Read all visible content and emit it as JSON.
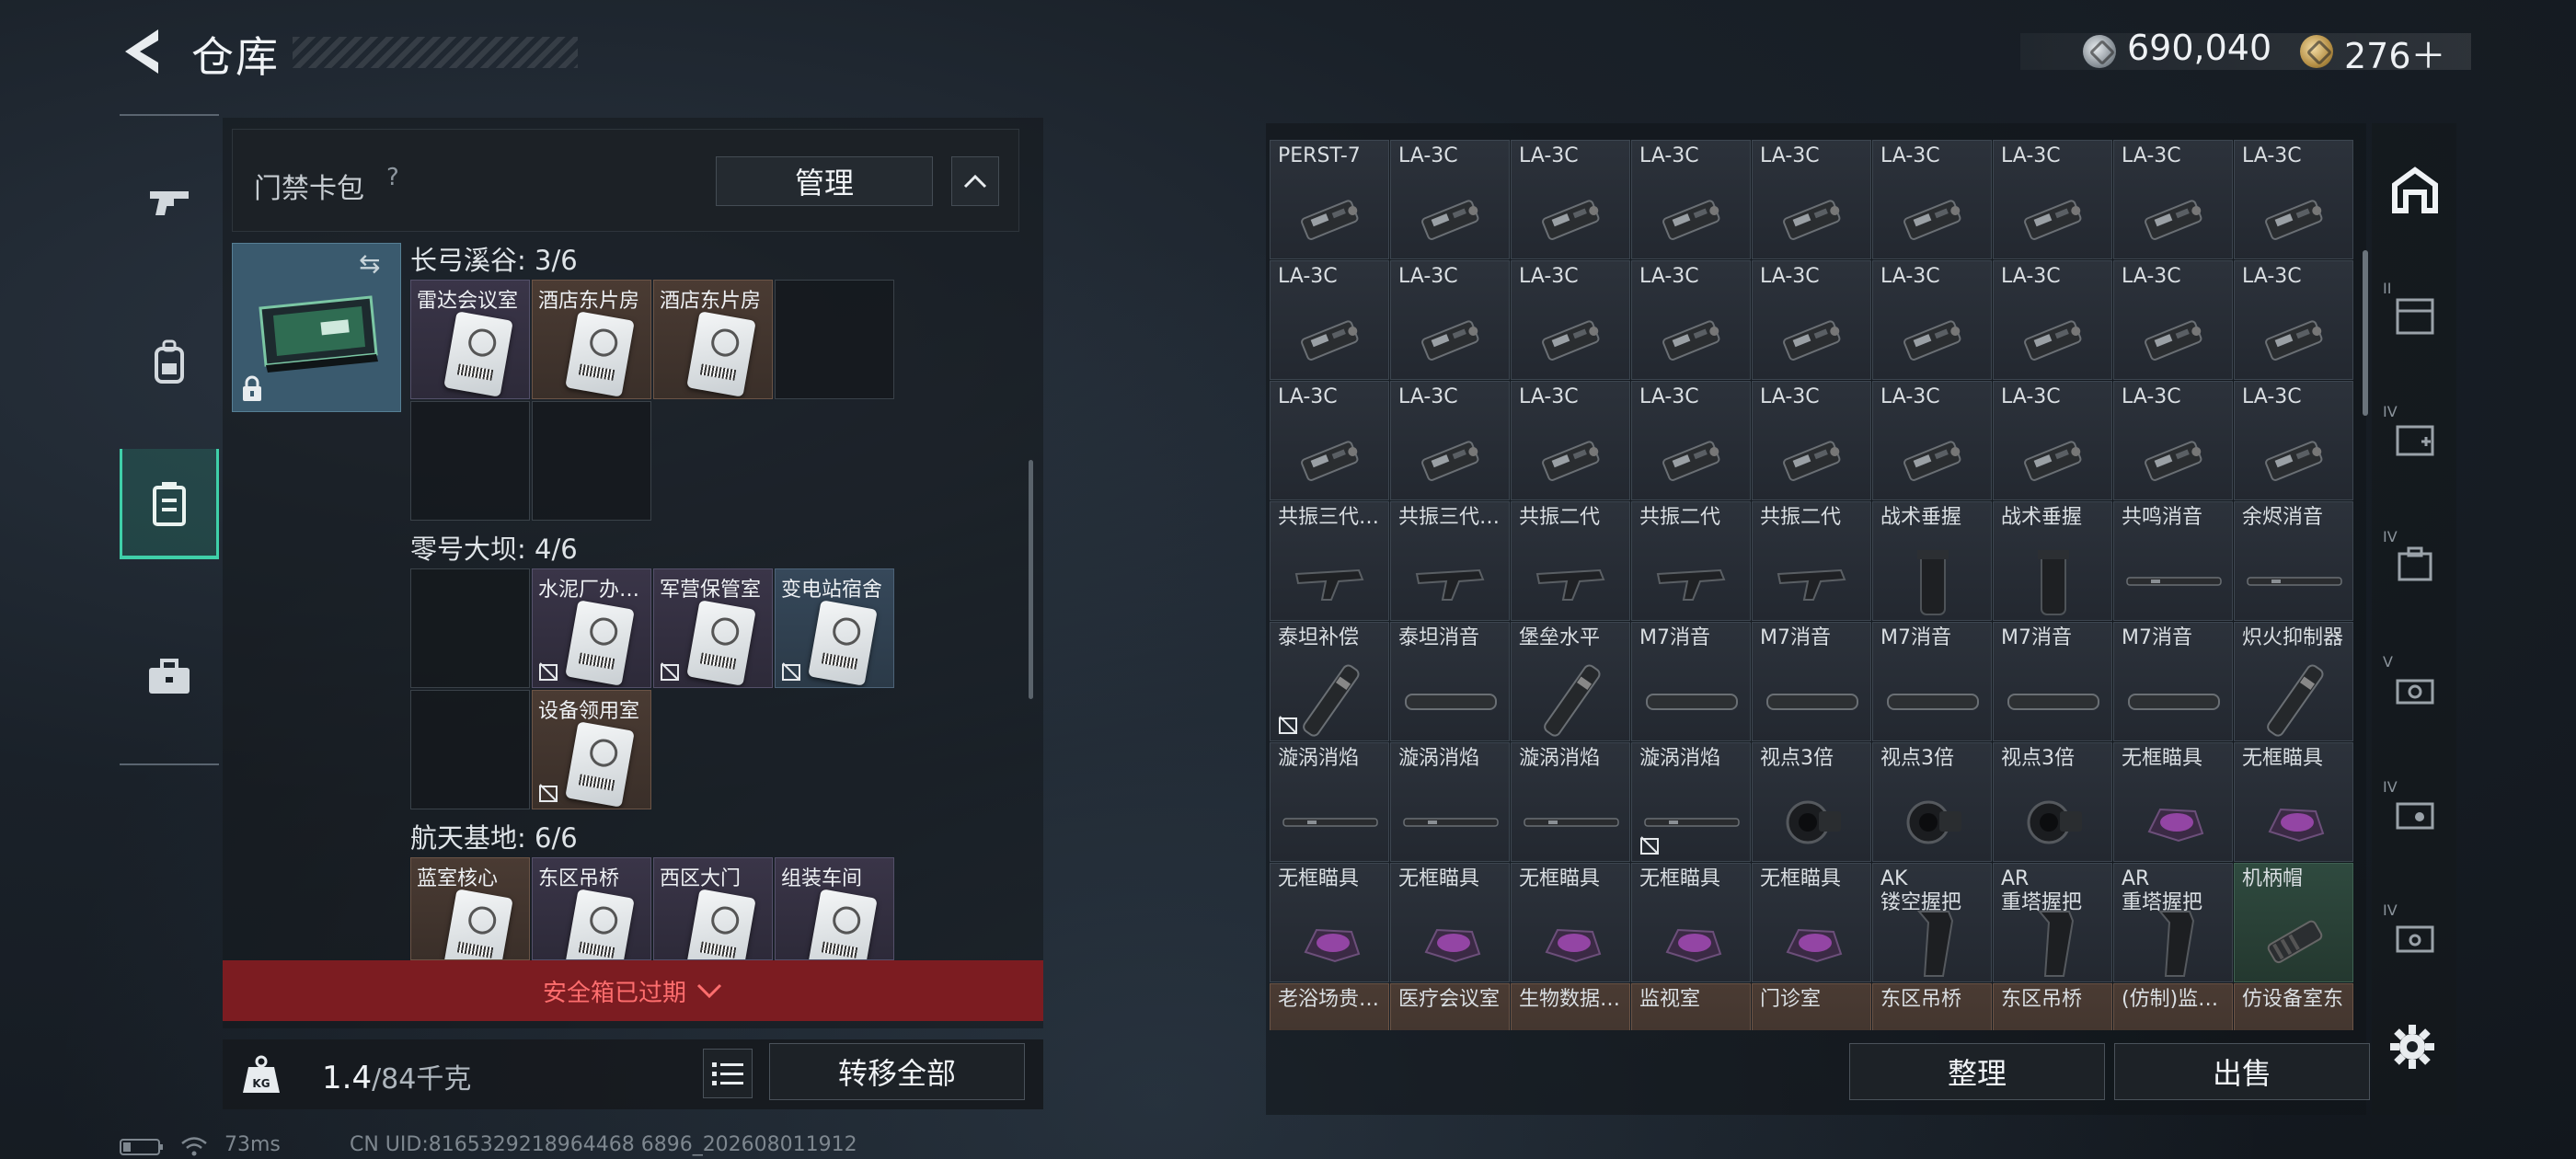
{
  "header": {
    "title": "仓库",
    "money": "690,040",
    "gold": "276＋"
  },
  "left_rail": {
    "items": [
      {
        "icon": "gun-icon",
        "active": false
      },
      {
        "icon": "backpack-icon",
        "active": false
      },
      {
        "icon": "safebox-icon",
        "active": true
      },
      {
        "icon": "toolbox-icon",
        "active": false
      }
    ]
  },
  "card_pack": {
    "title": "门禁卡包",
    "help": "?",
    "manage_label": "管理",
    "sections": [
      {
        "label": "长弓溪谷: 3/6",
        "cells": [
          {
            "label": "雷达会议室",
            "tone": "purple",
            "no_safe": false
          },
          {
            "label": "酒店东片房",
            "tone": "orange",
            "no_safe": false
          },
          {
            "label": "酒店东片房",
            "tone": "orange",
            "no_safe": false
          }
        ]
      },
      {
        "label": "零号大坝: 4/6",
        "cells": [
          {
            "label": "水泥厂办…",
            "tone": "purple",
            "no_safe": true
          },
          {
            "label": "军营保管室",
            "tone": "purple",
            "no_safe": true
          },
          {
            "label": "变电站宿舍",
            "tone": "blue",
            "no_safe": true
          },
          {
            "label": "设备领用室",
            "tone": "orange",
            "no_safe": true
          }
        ]
      },
      {
        "label": "航天基地: 6/6",
        "cells": [
          {
            "label": "蓝室核心",
            "tone": "orange",
            "no_safe": false
          },
          {
            "label": "东区吊桥",
            "tone": "purple",
            "no_safe": false
          },
          {
            "label": "西区大门",
            "tone": "purple",
            "no_safe": false
          },
          {
            "label": "组装车间",
            "tone": "purple",
            "no_safe": false
          }
        ]
      }
    ],
    "expired_text": "安全箱已过期",
    "weight_current": "1.4",
    "weight_max": "/84千克",
    "transfer_all_label": "转移全部"
  },
  "warehouse": {
    "rows": [
      [
        {
          "label": "PERST-7",
          "art": "laser"
        },
        {
          "label": "LA-3C",
          "art": "laser"
        },
        {
          "label": "LA-3C",
          "art": "laser"
        },
        {
          "label": "LA-3C",
          "art": "laser"
        },
        {
          "label": "LA-3C",
          "art": "laser"
        },
        {
          "label": "LA-3C",
          "art": "laser"
        },
        {
          "label": "LA-3C",
          "art": "laser"
        },
        {
          "label": "LA-3C",
          "art": "laser"
        },
        {
          "label": "LA-3C",
          "art": "laser"
        }
      ],
      [
        {
          "label": "LA-3C",
          "art": "laser"
        },
        {
          "label": "LA-3C",
          "art": "laser"
        },
        {
          "label": "LA-3C",
          "art": "laser"
        },
        {
          "label": "LA-3C",
          "art": "laser"
        },
        {
          "label": "LA-3C",
          "art": "laser"
        },
        {
          "label": "LA-3C",
          "art": "laser"
        },
        {
          "label": "LA-3C",
          "art": "laser"
        },
        {
          "label": "LA-3C",
          "art": "laser"
        },
        {
          "label": "LA-3C",
          "art": "laser"
        }
      ],
      [
        {
          "label": "LA-3C",
          "art": "laser"
        },
        {
          "label": "LA-3C",
          "art": "laser"
        },
        {
          "label": "LA-3C",
          "art": "laser"
        },
        {
          "label": "LA-3C",
          "art": "laser"
        },
        {
          "label": "LA-3C",
          "art": "laser"
        },
        {
          "label": "LA-3C",
          "art": "laser"
        },
        {
          "label": "LA-3C",
          "art": "laser"
        },
        {
          "label": "LA-3C",
          "art": "laser"
        },
        {
          "label": "LA-3C",
          "art": "laser"
        }
      ],
      [
        {
          "label": "共振三代…",
          "art": "grip"
        },
        {
          "label": "共振三代…",
          "art": "grip"
        },
        {
          "label": "共振二代",
          "art": "grip"
        },
        {
          "label": "共振二代",
          "art": "grip"
        },
        {
          "label": "共振二代",
          "art": "grip"
        },
        {
          "label": "战术垂握",
          "art": "vgrip"
        },
        {
          "label": "战术垂握",
          "art": "vgrip"
        },
        {
          "label": "共鸣消音",
          "art": "rod"
        },
        {
          "label": "余烬消音",
          "art": "rod"
        }
      ],
      [
        {
          "label": "泰坦补偿",
          "art": "comp",
          "no_safe": true
        },
        {
          "label": "泰坦消音",
          "art": "can"
        },
        {
          "label": "堡垒水平",
          "art": "comp"
        },
        {
          "label": "M7消音",
          "art": "can"
        },
        {
          "label": "M7消音",
          "art": "can"
        },
        {
          "label": "M7消音",
          "art": "can"
        },
        {
          "label": "M7消音",
          "art": "can"
        },
        {
          "label": "M7消音",
          "art": "can"
        },
        {
          "label": "炽火抑制器",
          "art": "comp"
        }
      ],
      [
        {
          "label": "漩涡消焰",
          "art": "rod"
        },
        {
          "label": "漩涡消焰",
          "art": "rod"
        },
        {
          "label": "漩涡消焰",
          "art": "rod"
        },
        {
          "label": "漩涡消焰",
          "art": "rod",
          "no_safe": true
        },
        {
          "label": "视点3倍",
          "art": "scope"
        },
        {
          "label": "视点3倍",
          "art": "scope"
        },
        {
          "label": "视点3倍",
          "art": "scope"
        },
        {
          "label": "无框瞄具",
          "art": "holo"
        },
        {
          "label": "无框瞄具",
          "art": "holo"
        }
      ],
      [
        {
          "label": "无框瞄具",
          "art": "holo"
        },
        {
          "label": "无框瞄具",
          "art": "holo"
        },
        {
          "label": "无框瞄具",
          "art": "holo"
        },
        {
          "label": "无框瞄具",
          "art": "holo"
        },
        {
          "label": "无框瞄具",
          "art": "holo"
        },
        {
          "label": "AK\n镂空握把",
          "art": "pgrip"
        },
        {
          "label": "AR\n重塔握把",
          "art": "pgrip"
        },
        {
          "label": "AR\n重塔握把",
          "art": "pgrip"
        },
        {
          "label": "机柄帽",
          "art": "cap",
          "tone": "green"
        }
      ],
      [
        {
          "label": "老浴场贵…",
          "art": "card",
          "tone": "warm"
        },
        {
          "label": "医疗会议室",
          "art": "card",
          "tone": "warm"
        },
        {
          "label": "生物数据…",
          "art": "card",
          "tone": "warm"
        },
        {
          "label": "监视室",
          "art": "card",
          "tone": "warm"
        },
        {
          "label": "门诊室",
          "art": "card",
          "tone": "warm"
        },
        {
          "label": "东区吊桥",
          "art": "card",
          "tone": "warm"
        },
        {
          "label": "东区吊桥",
          "art": "card",
          "tone": "warm"
        },
        {
          "label": "(仿制)监…",
          "art": "card",
          "tone": "warm"
        },
        {
          "label": "仿设备室东",
          "art": "card",
          "tone": "warm"
        }
      ]
    ],
    "sort_label": "整理",
    "sell_label": "出售"
  },
  "right_rail": {
    "items": [
      {
        "icon": "stash-icon",
        "tier": ""
      },
      {
        "icon": "container-icon",
        "tier": "II"
      },
      {
        "icon": "medkit-icon",
        "tier": "IV"
      },
      {
        "icon": "bag-icon",
        "tier": "IV"
      },
      {
        "icon": "ammo-icon",
        "tier": "V"
      },
      {
        "icon": "gear-box-icon",
        "tier": "IV"
      },
      {
        "icon": "case-icon",
        "tier": "IV"
      }
    ]
  },
  "status": {
    "ping": "73ms",
    "uid": "CN UID:8165329218964468 6896_202608011912"
  }
}
